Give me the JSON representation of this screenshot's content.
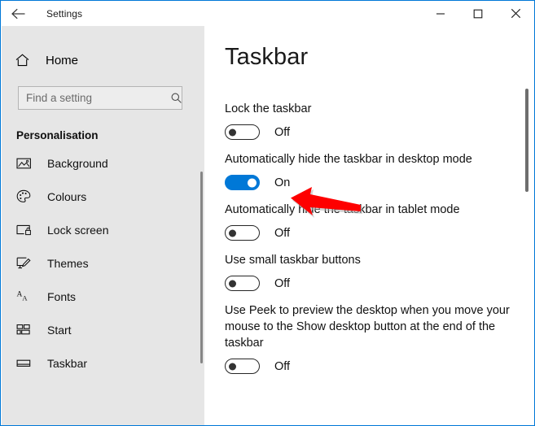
{
  "window": {
    "app_title": "Settings",
    "back_icon": "back-arrow-icon",
    "minimize_label": "–",
    "maximize_label": "□",
    "close_label": "×",
    "accent_color": "#0078d7",
    "sidebar_bg": "#e6e6e6"
  },
  "sidebar": {
    "home_label": "Home",
    "home_icon": "home-icon",
    "search": {
      "placeholder": "Find a setting",
      "value": "",
      "icon": "search-icon"
    },
    "section_title": "Personalisation",
    "items": [
      {
        "label": "Background",
        "icon": "picture-icon",
        "selected": false
      },
      {
        "label": "Colours",
        "icon": "palette-icon",
        "selected": false
      },
      {
        "label": "Lock screen",
        "icon": "lock-screen-icon",
        "selected": false
      },
      {
        "label": "Themes",
        "icon": "themes-brush-icon",
        "selected": false
      },
      {
        "label": "Fonts",
        "icon": "fonts-aa-icon",
        "selected": false
      },
      {
        "label": "Start",
        "icon": "start-tiles-icon",
        "selected": false
      },
      {
        "label": "Taskbar",
        "icon": "taskbar-bar-icon",
        "selected": true
      }
    ]
  },
  "main": {
    "page_title": "Taskbar",
    "settings": [
      {
        "label": "Lock the taskbar",
        "state": "Off",
        "on": false
      },
      {
        "label": "Automatically hide the taskbar in desktop mode",
        "state": "On",
        "on": true
      },
      {
        "label": "Automatically hide the taskbar in tablet mode",
        "state": "Off",
        "on": false
      },
      {
        "label": "Use small taskbar buttons",
        "state": "Off",
        "on": false
      },
      {
        "label": "Use Peek to preview the desktop when you move your mouse to the Show desktop button at the end of the taskbar",
        "state": "Off",
        "on": false
      }
    ]
  },
  "annotation": {
    "type": "arrow",
    "direction": "left",
    "color": "#fe0000",
    "points_at": "Automatically hide the taskbar in desktop mode toggle"
  }
}
